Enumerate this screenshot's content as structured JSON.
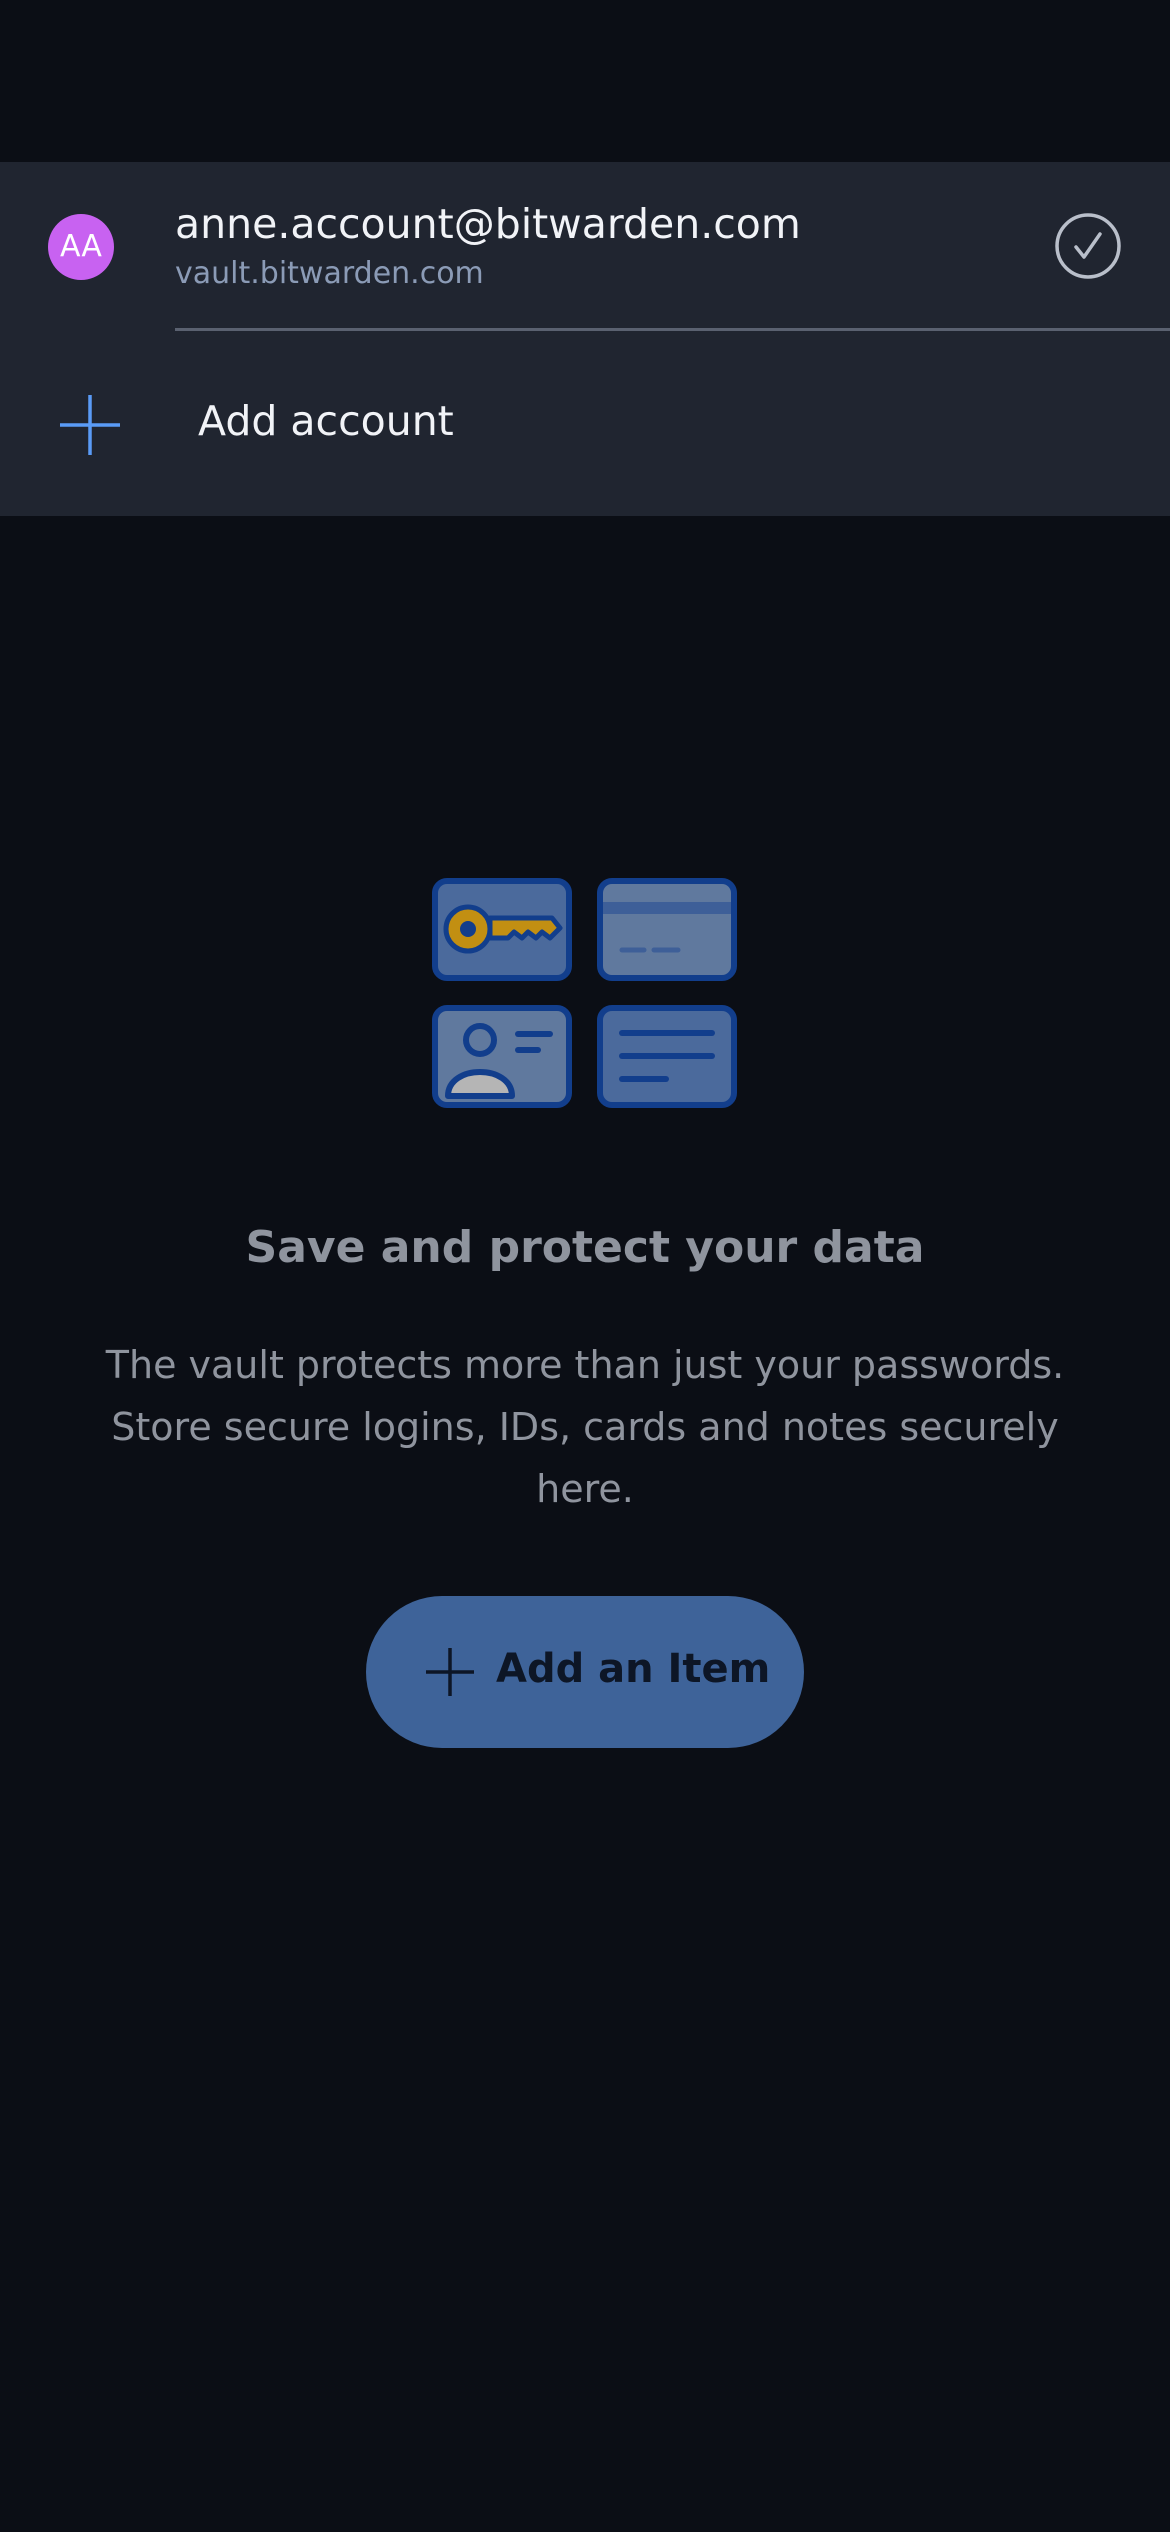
{
  "account_switcher": {
    "accounts": [
      {
        "initials": "AA",
        "email": "anne.account@bitwarden.com",
        "server": "vault.bitwarden.com",
        "avatar_color": "#c862f1",
        "active": true,
        "status_icon": "checkmark-circle-icon"
      }
    ],
    "add_account_label": "Add account",
    "add_account_icon": "plus-icon",
    "accent_color": "#5a9bf6"
  },
  "empty_state": {
    "illustration_icon": "vault-items-illustration",
    "title": "Save and protect your data",
    "description": "The vault protects more than just your passwords. Store secure logins, IDs, cards and notes securely here.",
    "add_item_label": "Add an Item",
    "add_item_icon": "plus-icon",
    "button_color": "#3e6399"
  }
}
